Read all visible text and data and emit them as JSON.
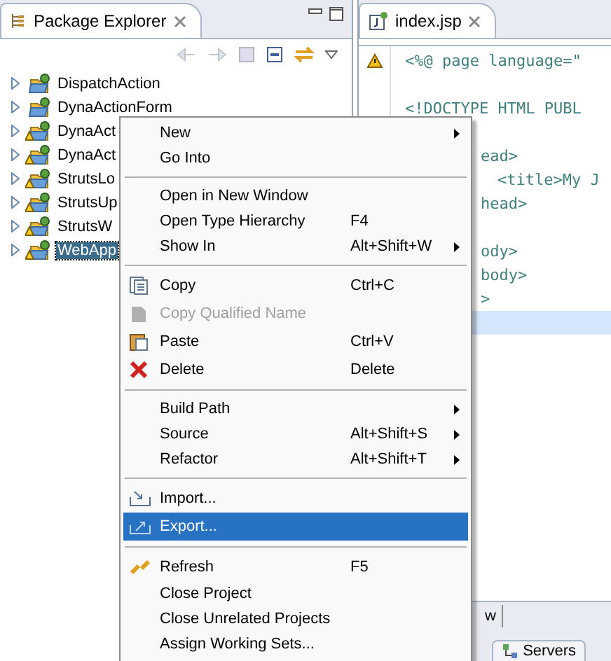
{
  "explorer": {
    "title": "Package Explorer",
    "items": [
      {
        "label": "DispatchAction",
        "warning": false,
        "selected": false
      },
      {
        "label": "DynaActionForm",
        "warning": false,
        "selected": false
      },
      {
        "label": "DynaAct",
        "warning": true,
        "selected": false
      },
      {
        "label": "DynaAct",
        "warning": true,
        "selected": false
      },
      {
        "label": "StrutsLo",
        "warning": true,
        "selected": false
      },
      {
        "label": "StrutsUp",
        "warning": true,
        "selected": false
      },
      {
        "label": "StrutsW",
        "warning": true,
        "selected": false
      },
      {
        "label": "WebApp",
        "warning": true,
        "selected": true
      }
    ]
  },
  "editor": {
    "tab": "index.jsp",
    "lines": [
      {
        "kind": "full",
        "text": "<%@ page language=\"",
        "warning": true,
        "current": false
      },
      {
        "kind": "full",
        "warning": false,
        "current": false
      },
      {
        "kind": "full",
        "text": "<!DOCTYPE HTML PUBL",
        "warning": false,
        "current": false
      },
      {
        "kind": "cut",
        "current": false
      },
      {
        "kind": "cut",
        "text": "ead>",
        "current": false
      },
      {
        "kind": "nested",
        "text": "<title>My J",
        "current": false
      },
      {
        "kind": "cut",
        "text": "head>",
        "current": false
      },
      {
        "kind": "cut",
        "current": false
      },
      {
        "kind": "cut",
        "text": "ody>",
        "current": false
      },
      {
        "kind": "cut",
        "text": "body>",
        "current": false
      },
      {
        "kind": "cut",
        "text": ">",
        "current": false
      },
      {
        "kind": "cut",
        "current": true
      }
    ]
  },
  "bottom_panel": {
    "tab_fragment": "w",
    "tabs": [
      {
        "label": "Servers"
      }
    ]
  },
  "context_menu": {
    "groups": [
      [
        {
          "kind": "plain",
          "label": "New",
          "submenu": true,
          "selected": false,
          "disabled": false
        },
        {
          "kind": "plain",
          "label": "Go Into",
          "selected": false,
          "disabled": false
        }
      ],
      [
        {
          "kind": "plain",
          "label": "Open in New Window",
          "selected": false,
          "disabled": false
        },
        {
          "kind": "plain",
          "label": "Open Type Hierarchy",
          "shortcut": "F4",
          "selected": false,
          "disabled": false
        },
        {
          "kind": "plain",
          "label": "Show In",
          "shortcut": "Alt+Shift+W",
          "submenu": true,
          "selected": false,
          "disabled": false
        }
      ],
      [
        {
          "kind": "copy",
          "label": "Copy",
          "shortcut": "Ctrl+C",
          "selected": false,
          "disabled": false
        },
        {
          "kind": "copy",
          "label": "Copy Qualified Name",
          "selected": false,
          "disabled": true
        },
        {
          "kind": "paste",
          "label": "Paste",
          "shortcut": "Ctrl+V",
          "selected": false,
          "disabled": false
        },
        {
          "kind": "delete",
          "label": "Delete",
          "shortcut": "Delete",
          "selected": false,
          "disabled": false
        }
      ],
      [
        {
          "kind": "plain",
          "label": "Build Path",
          "submenu": true,
          "selected": false,
          "disabled": false
        },
        {
          "kind": "plain",
          "label": "Source",
          "shortcut": "Alt+Shift+S",
          "submenu": true,
          "selected": false,
          "disabled": false
        },
        {
          "kind": "plain",
          "label": "Refactor",
          "shortcut": "Alt+Shift+T",
          "submenu": true,
          "selected": false,
          "disabled": false
        }
      ],
      [
        {
          "kind": "import",
          "label": "Import...",
          "selected": false,
          "disabled": false
        },
        {
          "kind": "export",
          "label": "Export...",
          "selected": true,
          "disabled": false
        }
      ],
      [
        {
          "kind": "refresh",
          "label": "Refresh",
          "shortcut": "F5",
          "selected": false,
          "disabled": false
        },
        {
          "kind": "plain",
          "label": "Close Project",
          "selected": false,
          "disabled": false
        },
        {
          "kind": "plain",
          "label": "Close Unrelated Projects",
          "selected": false,
          "disabled": false
        },
        {
          "kind": "plain",
          "label": "Assign Working Sets...",
          "selected": false,
          "disabled": false
        }
      ]
    ]
  }
}
